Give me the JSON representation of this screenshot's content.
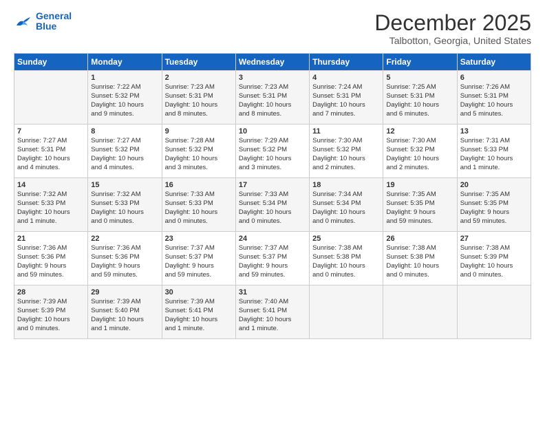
{
  "app": {
    "name": "GeneralBlue",
    "logo_text_line1": "General",
    "logo_text_line2": "Blue"
  },
  "header": {
    "month_year": "December 2025",
    "location": "Talbotton, Georgia, United States"
  },
  "weekdays": [
    "Sunday",
    "Monday",
    "Tuesday",
    "Wednesday",
    "Thursday",
    "Friday",
    "Saturday"
  ],
  "weeks": [
    [
      {
        "day": "",
        "info": ""
      },
      {
        "day": "1",
        "info": "Sunrise: 7:22 AM\nSunset: 5:32 PM\nDaylight: 10 hours\nand 9 minutes."
      },
      {
        "day": "2",
        "info": "Sunrise: 7:23 AM\nSunset: 5:31 PM\nDaylight: 10 hours\nand 8 minutes."
      },
      {
        "day": "3",
        "info": "Sunrise: 7:23 AM\nSunset: 5:31 PM\nDaylight: 10 hours\nand 8 minutes."
      },
      {
        "day": "4",
        "info": "Sunrise: 7:24 AM\nSunset: 5:31 PM\nDaylight: 10 hours\nand 7 minutes."
      },
      {
        "day": "5",
        "info": "Sunrise: 7:25 AM\nSunset: 5:31 PM\nDaylight: 10 hours\nand 6 minutes."
      },
      {
        "day": "6",
        "info": "Sunrise: 7:26 AM\nSunset: 5:31 PM\nDaylight: 10 hours\nand 5 minutes."
      }
    ],
    [
      {
        "day": "7",
        "info": "Sunrise: 7:27 AM\nSunset: 5:31 PM\nDaylight: 10 hours\nand 4 minutes."
      },
      {
        "day": "8",
        "info": "Sunrise: 7:27 AM\nSunset: 5:32 PM\nDaylight: 10 hours\nand 4 minutes."
      },
      {
        "day": "9",
        "info": "Sunrise: 7:28 AM\nSunset: 5:32 PM\nDaylight: 10 hours\nand 3 minutes."
      },
      {
        "day": "10",
        "info": "Sunrise: 7:29 AM\nSunset: 5:32 PM\nDaylight: 10 hours\nand 3 minutes."
      },
      {
        "day": "11",
        "info": "Sunrise: 7:30 AM\nSunset: 5:32 PM\nDaylight: 10 hours\nand 2 minutes."
      },
      {
        "day": "12",
        "info": "Sunrise: 7:30 AM\nSunset: 5:32 PM\nDaylight: 10 hours\nand 2 minutes."
      },
      {
        "day": "13",
        "info": "Sunrise: 7:31 AM\nSunset: 5:33 PM\nDaylight: 10 hours\nand 1 minute."
      }
    ],
    [
      {
        "day": "14",
        "info": "Sunrise: 7:32 AM\nSunset: 5:33 PM\nDaylight: 10 hours\nand 1 minute."
      },
      {
        "day": "15",
        "info": "Sunrise: 7:32 AM\nSunset: 5:33 PM\nDaylight: 10 hours\nand 0 minutes."
      },
      {
        "day": "16",
        "info": "Sunrise: 7:33 AM\nSunset: 5:33 PM\nDaylight: 10 hours\nand 0 minutes."
      },
      {
        "day": "17",
        "info": "Sunrise: 7:33 AM\nSunset: 5:34 PM\nDaylight: 10 hours\nand 0 minutes."
      },
      {
        "day": "18",
        "info": "Sunrise: 7:34 AM\nSunset: 5:34 PM\nDaylight: 10 hours\nand 0 minutes."
      },
      {
        "day": "19",
        "info": "Sunrise: 7:35 AM\nSunset: 5:35 PM\nDaylight: 9 hours\nand 59 minutes."
      },
      {
        "day": "20",
        "info": "Sunrise: 7:35 AM\nSunset: 5:35 PM\nDaylight: 9 hours\nand 59 minutes."
      }
    ],
    [
      {
        "day": "21",
        "info": "Sunrise: 7:36 AM\nSunset: 5:36 PM\nDaylight: 9 hours\nand 59 minutes."
      },
      {
        "day": "22",
        "info": "Sunrise: 7:36 AM\nSunset: 5:36 PM\nDaylight: 9 hours\nand 59 minutes."
      },
      {
        "day": "23",
        "info": "Sunrise: 7:37 AM\nSunset: 5:37 PM\nDaylight: 9 hours\nand 59 minutes."
      },
      {
        "day": "24",
        "info": "Sunrise: 7:37 AM\nSunset: 5:37 PM\nDaylight: 9 hours\nand 59 minutes."
      },
      {
        "day": "25",
        "info": "Sunrise: 7:38 AM\nSunset: 5:38 PM\nDaylight: 10 hours\nand 0 minutes."
      },
      {
        "day": "26",
        "info": "Sunrise: 7:38 AM\nSunset: 5:38 PM\nDaylight: 10 hours\nand 0 minutes."
      },
      {
        "day": "27",
        "info": "Sunrise: 7:38 AM\nSunset: 5:39 PM\nDaylight: 10 hours\nand 0 minutes."
      }
    ],
    [
      {
        "day": "28",
        "info": "Sunrise: 7:39 AM\nSunset: 5:39 PM\nDaylight: 10 hours\nand 0 minutes."
      },
      {
        "day": "29",
        "info": "Sunrise: 7:39 AM\nSunset: 5:40 PM\nDaylight: 10 hours\nand 1 minute."
      },
      {
        "day": "30",
        "info": "Sunrise: 7:39 AM\nSunset: 5:41 PM\nDaylight: 10 hours\nand 1 minute."
      },
      {
        "day": "31",
        "info": "Sunrise: 7:40 AM\nSunset: 5:41 PM\nDaylight: 10 hours\nand 1 minute."
      },
      {
        "day": "",
        "info": ""
      },
      {
        "day": "",
        "info": ""
      },
      {
        "day": "",
        "info": ""
      }
    ]
  ]
}
